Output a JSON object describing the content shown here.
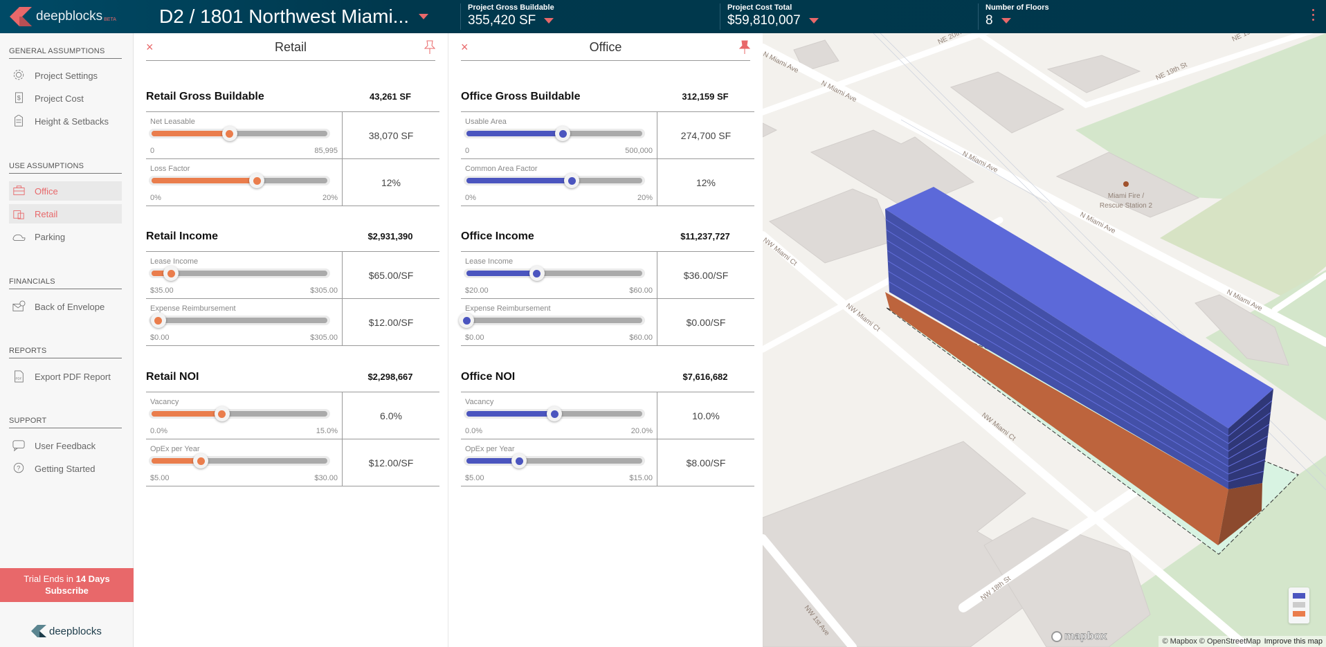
{
  "header": {
    "logo_text": "deepblocks",
    "logo_badge": "BETA",
    "project_title": "D2 / 1801 Northwest Miami...",
    "stats": [
      {
        "label": "Project Gross Buildable",
        "value": "355,420 SF"
      },
      {
        "label": "Project Cost Total",
        "value": "$59,810,007"
      },
      {
        "label": "Number of Floors",
        "value": "8"
      }
    ]
  },
  "sidebar": {
    "sections": [
      {
        "title": "GENERAL ASSUMPTIONS",
        "items": [
          {
            "label": "Project Settings",
            "icon": "gear-icon"
          },
          {
            "label": "Project Cost",
            "icon": "receipt-dollar-icon"
          },
          {
            "label": "Height & Setbacks",
            "icon": "sliders-icon"
          }
        ]
      },
      {
        "title": "USE ASSUMPTIONS",
        "items": [
          {
            "label": "Office",
            "icon": "briefcase-icon",
            "active": true
          },
          {
            "label": "Retail",
            "icon": "shopping-bag-icon",
            "active": true
          },
          {
            "label": "Parking",
            "icon": "cars-icon"
          }
        ]
      },
      {
        "title": "FINANCIALS",
        "items": [
          {
            "label": "Back of Envelope",
            "icon": "envelope-check-icon"
          }
        ]
      },
      {
        "title": "REPORTS",
        "items": [
          {
            "label": "Export PDF Report",
            "icon": "pdf-icon"
          }
        ]
      },
      {
        "title": "SUPPORT",
        "items": [
          {
            "label": "User Feedback",
            "icon": "chat-icon"
          },
          {
            "label": "Getting Started",
            "icon": "help-icon"
          }
        ]
      }
    ],
    "trial_prefix": "Trial Ends in ",
    "trial_days": "14 Days",
    "subscribe": "Subscribe",
    "footer_logo": "deepblocks"
  },
  "panels": [
    {
      "title": "Retail",
      "color": "#ea7d4c",
      "pinned": false,
      "sections": [
        {
          "title": "Retail Gross Buildable",
          "value": "43,261 SF",
          "rows": [
            {
              "label": "Net Leasable",
              "min": "0",
              "max": "85,995",
              "value": "38,070 SF",
              "fraction": 0.443
            },
            {
              "label": "Loss Factor",
              "min": "0%",
              "max": "20%",
              "value": "12%",
              "fraction": 0.6
            }
          ]
        },
        {
          "title": "Retail Income",
          "value": "$2,931,390",
          "rows": [
            {
              "label": "Lease Income",
              "min": "$35.00",
              "max": "$305.00",
              "value": "$65.00/SF",
              "fraction": 0.111
            },
            {
              "label": "Expense Reimbursement",
              "min": "$0.00",
              "max": "$305.00",
              "value": "$12.00/SF",
              "fraction": 0.039
            }
          ]
        },
        {
          "title": "Retail NOI",
          "value": "$2,298,667",
          "rows": [
            {
              "label": "Vacancy",
              "min": "0.0%",
              "max": "15.0%",
              "value": "6.0%",
              "fraction": 0.4
            },
            {
              "label": "OpEx per Year",
              "min": "$5.00",
              "max": "$30.00",
              "value": "$12.00/SF",
              "fraction": 0.28
            }
          ]
        }
      ]
    },
    {
      "title": "Office",
      "color": "#4b55bf",
      "pinned": true,
      "sections": [
        {
          "title": "Office Gross Buildable",
          "value": "312,159 SF",
          "rows": [
            {
              "label": "Usable Area",
              "min": "0",
              "max": "500,000",
              "value": "274,700 SF",
              "fraction": 0.549
            },
            {
              "label": "Common Area Factor",
              "min": "0%",
              "max": "20%",
              "value": "12%",
              "fraction": 0.6
            }
          ]
        },
        {
          "title": "Office Income",
          "value": "$11,237,727",
          "rows": [
            {
              "label": "Lease Income",
              "min": "$20.00",
              "max": "$60.00",
              "value": "$36.00/SF",
              "fraction": 0.4
            },
            {
              "label": "Expense Reimbursement",
              "min": "$0.00",
              "max": "$60.00",
              "value": "$0.00/SF",
              "fraction": 0
            }
          ]
        },
        {
          "title": "Office NOI",
          "value": "$7,616,682",
          "rows": [
            {
              "label": "Vacancy",
              "min": "0.0%",
              "max": "20.0%",
              "value": "10.0%",
              "fraction": 0.5
            },
            {
              "label": "OpEx per Year",
              "min": "$5.00",
              "max": "$15.00",
              "value": "$8.00/SF",
              "fraction": 0.3
            }
          ]
        }
      ]
    }
  ],
  "map": {
    "labels": {
      "ne20": "NE 20th St",
      "ne19a": "NE 19th St",
      "ne19b": "NE 19th St",
      "nmiami1": "N Miami Ave",
      "nmiami2": "N Miami Ave",
      "nmiami3": "N Miami Ave",
      "nmiami4": "N Miami Ave",
      "nwct1": "NW Miami Ct",
      "nwct2": "NW Miami Ct",
      "nwct0": "NW Miami Ct",
      "nw18": "NW 18th St",
      "nw1ave": "NW 1st Ave",
      "fire1": "Miami Fire /",
      "fire2": "Rescue Station 2"
    },
    "legend_colors": {
      "office": "#4b55bf",
      "parking": "#cccccc",
      "retail": "#ea7d4c"
    },
    "mapbox_logo": "mapbox",
    "attribution": "© Mapbox © OpenStreetMap",
    "improve": "Improve this map"
  }
}
